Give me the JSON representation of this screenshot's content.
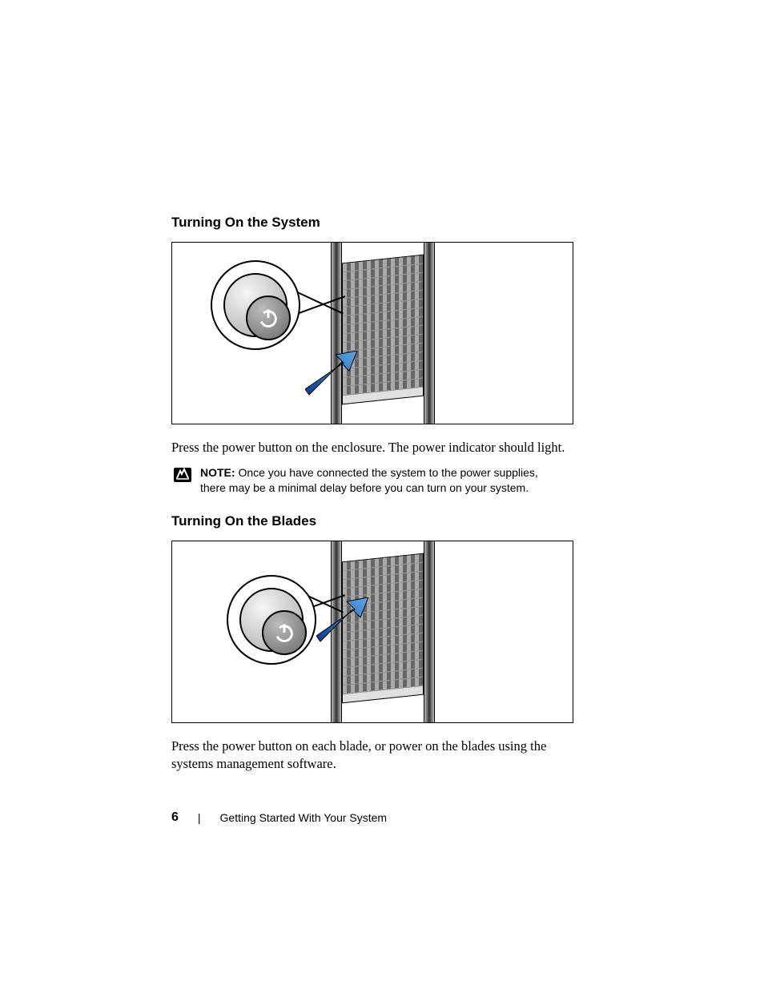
{
  "section1": {
    "heading": "Turning On the System",
    "body": "Press the power button on the enclosure. The power indicator should light."
  },
  "note": {
    "label": "NOTE:",
    "text": " Once you have connected the system to the power supplies, there may be a minimal delay before you can turn on your system."
  },
  "section2": {
    "heading": "Turning On the Blades",
    "body": "Press the power button on each blade, or power on the blades using the systems management software."
  },
  "footer": {
    "page_number": "6",
    "separator": "|",
    "title": "Getting Started With Your System"
  }
}
